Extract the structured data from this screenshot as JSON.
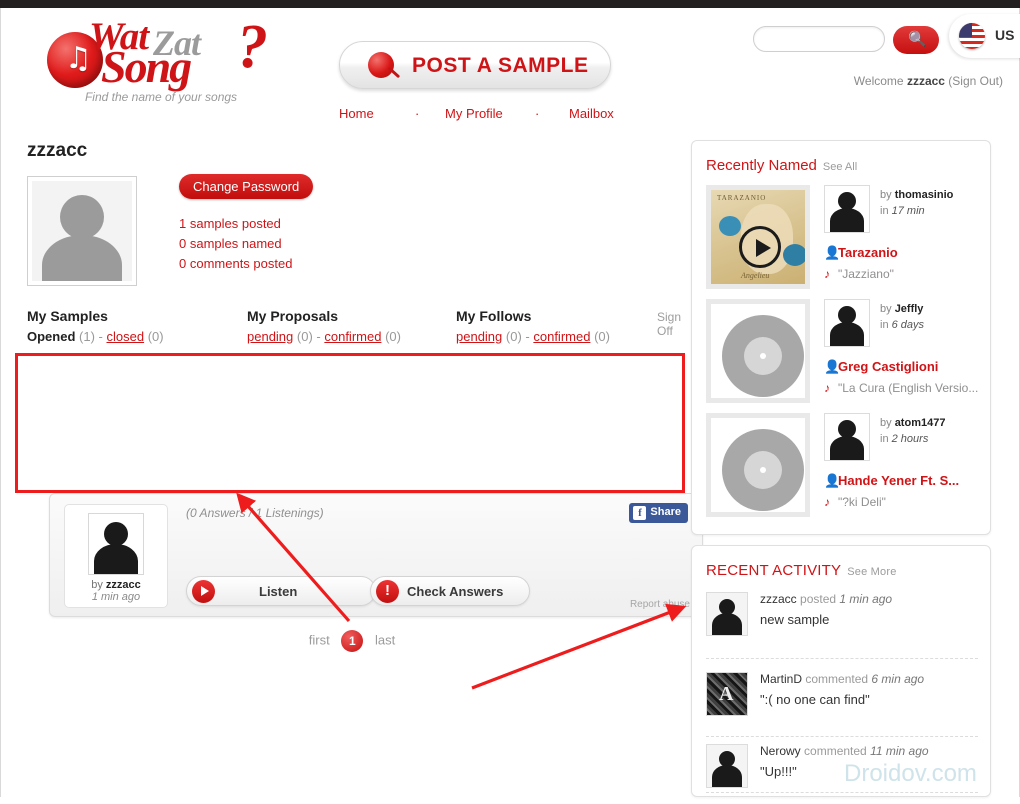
{
  "site": {
    "logo_wat": "Wat",
    "logo_zat": "Zat",
    "logo_song": "Song",
    "logo_q": "?",
    "tagline": "Find the name of your songs",
    "brand_red": "#cf1417",
    "watermark": "Droidov.com"
  },
  "header": {
    "post_button": "POST A SAMPLE",
    "post_icon": "microphone-icon",
    "nav": [
      {
        "label": "Home"
      },
      {
        "label": "My Profile"
      },
      {
        "label": "Mailbox"
      }
    ],
    "nav_separator": "·",
    "search": {
      "value": "",
      "placeholder": "",
      "icon": "search-icon"
    },
    "language": {
      "code": "US",
      "icon": "us-flag-icon"
    },
    "welcome_prefix": "Welcome ",
    "welcome_user": "zzzacc",
    "welcome_suffix": " (Sign Out)"
  },
  "profile": {
    "username": "zzzacc",
    "change_password": "Change Password",
    "sign_off": "Sign Off",
    "stats": [
      "1 samples posted",
      "0 samples named",
      "0 comments posted"
    ]
  },
  "columns": [
    {
      "title": "My Samples",
      "links": [
        {
          "label": "Opened",
          "count": "(1)",
          "active": true
        },
        {
          "label": "closed",
          "count": "(0)",
          "active": false
        }
      ]
    },
    {
      "title": "My Proposals",
      "links": [
        {
          "label": "pending",
          "count": "(0)",
          "active": false
        },
        {
          "label": "confirmed",
          "count": "(0)",
          "active": false
        }
      ]
    },
    {
      "title": "My Follows",
      "links": [
        {
          "label": "pending",
          "count": "(0)",
          "active": false
        },
        {
          "label": "confirmed",
          "count": "(0)",
          "active": false
        }
      ]
    }
  ],
  "sample": {
    "answers_info": "(0 Answers / 1 Listenings)",
    "share_label": "Share",
    "share_icon": "facebook-icon",
    "by_prefix": "by ",
    "by_user": "zzzacc",
    "posted_ago": "1 min ago",
    "listen_label": "Listen",
    "listen_icon": "play-icon",
    "check_label": "Check Answers",
    "check_icon": "alert-icon",
    "report_abuse": "Report abuse"
  },
  "pagination": {
    "first": "first",
    "current": "1",
    "last": "last"
  },
  "recently_named": {
    "title": "Recently Named",
    "see_all": "See All",
    "items": [
      {
        "by_prefix": "by ",
        "by_user": "thomasinio",
        "in_prefix": "in ",
        "in_time": "17 min",
        "artist": "Tarazanio",
        "song": "\"Jazziano\"",
        "artwork": "album-art-tarazanio",
        "has_play": true
      },
      {
        "by_prefix": "by ",
        "by_user": "Jeffly",
        "in_prefix": "in ",
        "in_time": "6 days",
        "artist": "Greg Castiglioni",
        "song": "\"La Cura (English Versio...",
        "artwork": "vinyl-placeholder",
        "has_play": false
      },
      {
        "by_prefix": "by ",
        "by_user": "atom1477",
        "in_prefix": "in ",
        "in_time": "2 hours",
        "artist": "Hande Yener Ft. S...",
        "song": "\"?ki Deli\"",
        "artwork": "vinyl-placeholder",
        "has_play": false
      }
    ],
    "artist_icon": "person-icon",
    "song_icon": "music-note-icon"
  },
  "recent_activity": {
    "title": "RECENT ACTIVITY",
    "see_more": "See More",
    "items": [
      {
        "user": "zzzacc",
        "action": "posted",
        "time": "1 min ago",
        "text": "new sample",
        "avatar": "silhouette"
      },
      {
        "user": "MartinD",
        "action": "commented",
        "time": "6 min ago",
        "text": "\":( no one can find\"",
        "avatar": "photo"
      },
      {
        "user": "Nerowy",
        "action": "commented",
        "time": "11 min ago",
        "text": "\"Up!!!\"",
        "avatar": "silhouette"
      }
    ]
  },
  "annotations": {
    "highlight_color": "#ee1c1c",
    "arrow_count": 2
  }
}
